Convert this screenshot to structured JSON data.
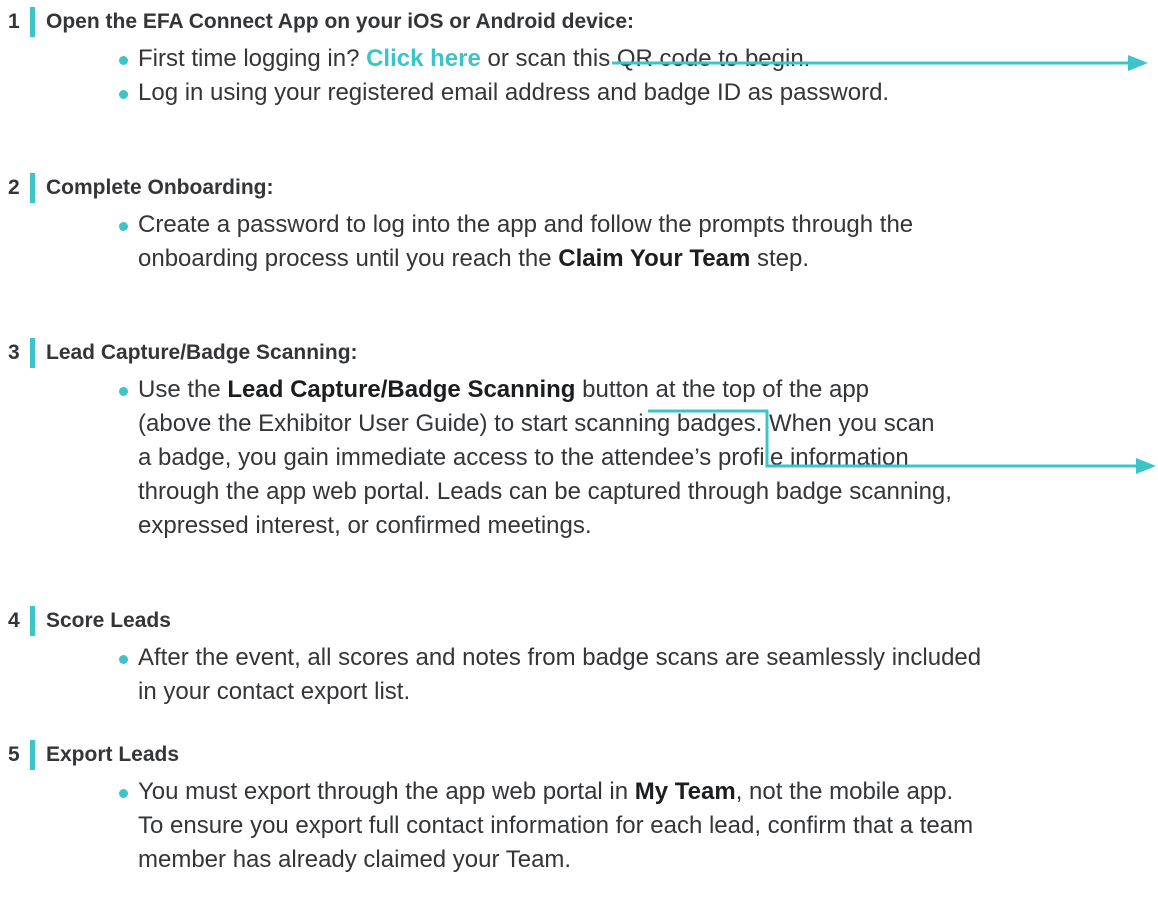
{
  "steps": [
    {
      "number": "1",
      "title": "Open the EFA Connect App on your iOS or Android device:",
      "bullets": [
        {
          "pre": "First time logging in? ",
          "link": "Click here",
          "post": " or scan this QR code to begin."
        },
        {
          "text": "Log in using your registered email address and badge ID as password."
        }
      ]
    },
    {
      "number": "2",
      "title": "Complete Onboarding:",
      "bullets": [
        {
          "line1": "Create a password to log into the app and follow the prompts through the",
          "pre": "onboarding process until you reach the ",
          "bold": "Claim Your Team",
          "post": " step."
        }
      ]
    },
    {
      "number": "3",
      "title": "Lead Capture/Badge Scanning:",
      "bullets": [
        {
          "pre": "Use the ",
          "bold": "Lead Capture/Badge Scanning",
          "post": " button at the top of the app",
          "lines": [
            "(above the Exhibitor User Guide) to start scanning badges. When you scan",
            "a badge, you gain immediate access to the attendee’s profile information",
            "through the app web portal. Leads can be captured through badge scanning,",
            "expressed interest, or confirmed meetings."
          ]
        }
      ]
    },
    {
      "number": "4",
      "title": "Score Leads",
      "bullets": [
        {
          "lines": [
            "After the event, all scores and notes from badge scans are seamlessly included",
            "in your contact export list."
          ]
        }
      ]
    },
    {
      "number": "5",
      "title": "Export Leads",
      "bullets": [
        {
          "pre": "You must export through the app web portal in ",
          "bold": "My Team",
          "post": ", not the mobile app.",
          "lines": [
            "To ensure you export full contact information for each lead, confirm that a team",
            "member has already claimed your Team."
          ]
        }
      ]
    }
  ],
  "colors": {
    "accent": "#3cc4c8",
    "text": "#333538"
  }
}
